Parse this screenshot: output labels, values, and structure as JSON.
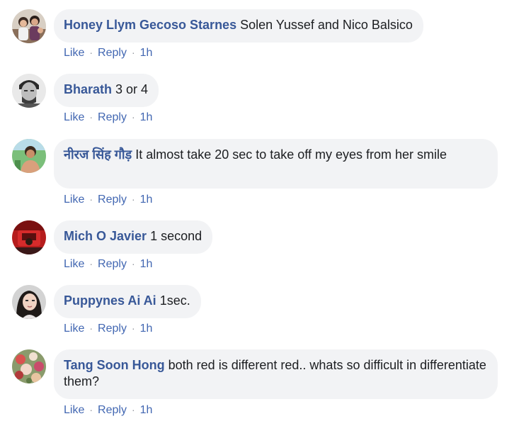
{
  "comments": [
    {
      "author": "Honey Llym Gecoso Starnes",
      "text": "Solen Yussef and Nico Balsico",
      "like_label": "Like",
      "reply_label": "Reply",
      "time": "1h",
      "avatar": "family-photo-avatar"
    },
    {
      "author": "Bharath",
      "text": "3 or 4",
      "like_label": "Like",
      "reply_label": "Reply",
      "time": "1h",
      "avatar": "man-bw-photo-avatar"
    },
    {
      "author": "नीरज सिंह गौड़",
      "text": "It almost take 20 sec to take off my eyes from her smile",
      "like_label": "Like",
      "reply_label": "Reply",
      "time": "1h",
      "avatar": "man-outdoor-photo-avatar"
    },
    {
      "author": "Mich O Javier",
      "text": "1 second",
      "like_label": "Like",
      "reply_label": "Reply",
      "time": "1h",
      "avatar": "red-car-photo-avatar"
    },
    {
      "author": "Puppynes Ai Ai",
      "text": "1sec.",
      "like_label": "Like",
      "reply_label": "Reply",
      "time": "1h",
      "avatar": "woman-photo-avatar"
    },
    {
      "author": "Tang Soon Hong",
      "text": "both red is different red.. whats so difficult in differentiate them?",
      "like_label": "Like",
      "reply_label": "Reply",
      "time": "1h",
      "avatar": "flowers-photo-avatar"
    }
  ],
  "colors": {
    "author": "#385898",
    "bubble": "#f2f3f5",
    "action": "#4267b2"
  }
}
